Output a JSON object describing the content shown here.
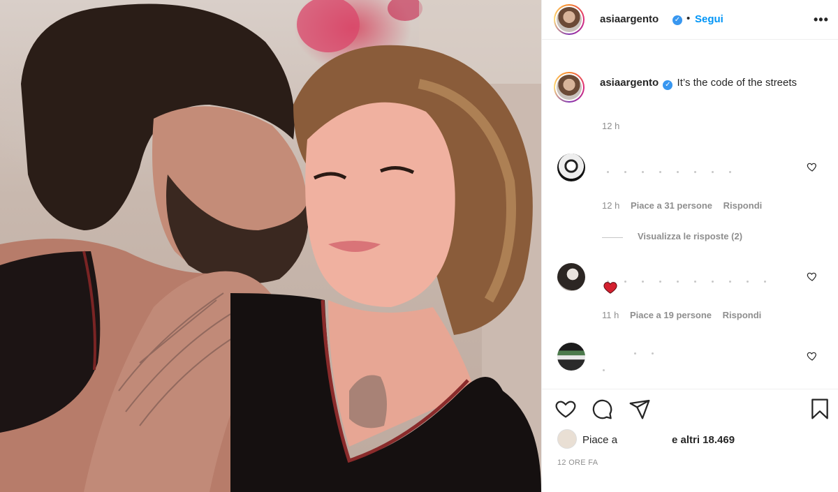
{
  "post": {
    "username": "asiaargento",
    "follow_label": "Segui",
    "separator": "•",
    "more_label": "•••"
  },
  "caption": {
    "username": "asiaargento",
    "text": "It’s the code of the streets",
    "time": "12 h"
  },
  "comments": [
    {
      "time": "12 h",
      "likes": "Piace a 31 persone",
      "reply": "Rispondi",
      "view_replies": "Visualizza le risposte (2)"
    },
    {
      "time": "11 h",
      "likes": "Piace a 19 persone",
      "reply": "Rispondi"
    }
  ],
  "footer": {
    "liked_prefix": "Piace a",
    "liked_suffix": "e altri 18.469",
    "posted_ago": "12 ORE FA"
  },
  "colors": {
    "accent_blue": "#0095f6",
    "verified_blue": "#3897f0",
    "heart_red": "#ed4956",
    "muted_text": "#8e8e8e"
  },
  "icons": [
    "heart-icon",
    "comment-icon",
    "share-icon",
    "bookmark-icon",
    "verified-icon",
    "more-icon"
  ]
}
